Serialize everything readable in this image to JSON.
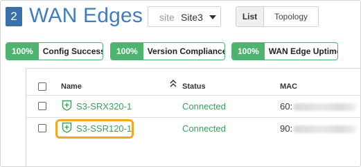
{
  "header": {
    "count": "2",
    "title": "WAN Edges",
    "site_label": "site",
    "site_value": "Site3",
    "views": [
      "List",
      "Topology"
    ]
  },
  "metrics": [
    {
      "percent": "100%",
      "label": "Config Success"
    },
    {
      "percent": "100%",
      "label": "Version Compliance"
    },
    {
      "percent": "100%",
      "label": "WAN Edge Uptime"
    }
  ],
  "table": {
    "columns": [
      "Name",
      "Status",
      "MAC"
    ],
    "rows": [
      {
        "name": "S3-SRX320-1",
        "status": "Connected",
        "mac": "60:"
      },
      {
        "name": "S3-SSR120-1",
        "status": "Connected",
        "mac": "90:"
      }
    ]
  },
  "colors": {
    "accent_blue": "#3f7cc0",
    "badge_blue": "#3a6fa8",
    "success_green": "#4cb46e",
    "status_green": "#3aa05a",
    "highlight_orange": "#f5a623"
  }
}
